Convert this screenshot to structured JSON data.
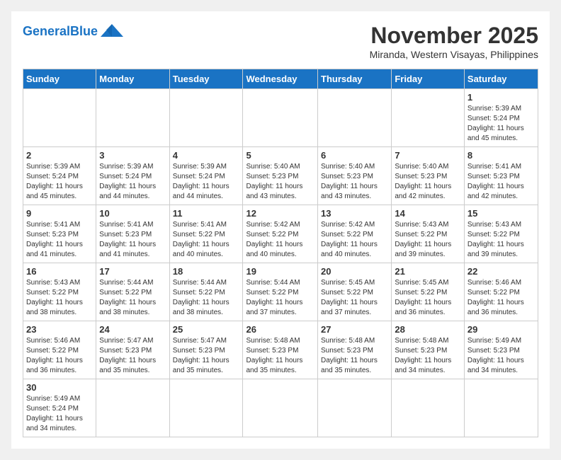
{
  "header": {
    "logo_general": "General",
    "logo_blue": "Blue",
    "month": "November 2025",
    "location": "Miranda, Western Visayas, Philippines"
  },
  "days_of_week": [
    "Sunday",
    "Monday",
    "Tuesday",
    "Wednesday",
    "Thursday",
    "Friday",
    "Saturday"
  ],
  "weeks": [
    [
      {
        "day": "",
        "info": ""
      },
      {
        "day": "",
        "info": ""
      },
      {
        "day": "",
        "info": ""
      },
      {
        "day": "",
        "info": ""
      },
      {
        "day": "",
        "info": ""
      },
      {
        "day": "",
        "info": ""
      },
      {
        "day": "1",
        "info": "Sunrise: 5:39 AM\nSunset: 5:24 PM\nDaylight: 11 hours\nand 45 minutes."
      }
    ],
    [
      {
        "day": "2",
        "info": "Sunrise: 5:39 AM\nSunset: 5:24 PM\nDaylight: 11 hours\nand 45 minutes."
      },
      {
        "day": "3",
        "info": "Sunrise: 5:39 AM\nSunset: 5:24 PM\nDaylight: 11 hours\nand 44 minutes."
      },
      {
        "day": "4",
        "info": "Sunrise: 5:39 AM\nSunset: 5:24 PM\nDaylight: 11 hours\nand 44 minutes."
      },
      {
        "day": "5",
        "info": "Sunrise: 5:40 AM\nSunset: 5:23 PM\nDaylight: 11 hours\nand 43 minutes."
      },
      {
        "day": "6",
        "info": "Sunrise: 5:40 AM\nSunset: 5:23 PM\nDaylight: 11 hours\nand 43 minutes."
      },
      {
        "day": "7",
        "info": "Sunrise: 5:40 AM\nSunset: 5:23 PM\nDaylight: 11 hours\nand 42 minutes."
      },
      {
        "day": "8",
        "info": "Sunrise: 5:41 AM\nSunset: 5:23 PM\nDaylight: 11 hours\nand 42 minutes."
      }
    ],
    [
      {
        "day": "9",
        "info": "Sunrise: 5:41 AM\nSunset: 5:23 PM\nDaylight: 11 hours\nand 41 minutes."
      },
      {
        "day": "10",
        "info": "Sunrise: 5:41 AM\nSunset: 5:23 PM\nDaylight: 11 hours\nand 41 minutes."
      },
      {
        "day": "11",
        "info": "Sunrise: 5:41 AM\nSunset: 5:22 PM\nDaylight: 11 hours\nand 40 minutes."
      },
      {
        "day": "12",
        "info": "Sunrise: 5:42 AM\nSunset: 5:22 PM\nDaylight: 11 hours\nand 40 minutes."
      },
      {
        "day": "13",
        "info": "Sunrise: 5:42 AM\nSunset: 5:22 PM\nDaylight: 11 hours\nand 40 minutes."
      },
      {
        "day": "14",
        "info": "Sunrise: 5:43 AM\nSunset: 5:22 PM\nDaylight: 11 hours\nand 39 minutes."
      },
      {
        "day": "15",
        "info": "Sunrise: 5:43 AM\nSunset: 5:22 PM\nDaylight: 11 hours\nand 39 minutes."
      }
    ],
    [
      {
        "day": "16",
        "info": "Sunrise: 5:43 AM\nSunset: 5:22 PM\nDaylight: 11 hours\nand 38 minutes."
      },
      {
        "day": "17",
        "info": "Sunrise: 5:44 AM\nSunset: 5:22 PM\nDaylight: 11 hours\nand 38 minutes."
      },
      {
        "day": "18",
        "info": "Sunrise: 5:44 AM\nSunset: 5:22 PM\nDaylight: 11 hours\nand 38 minutes."
      },
      {
        "day": "19",
        "info": "Sunrise: 5:44 AM\nSunset: 5:22 PM\nDaylight: 11 hours\nand 37 minutes."
      },
      {
        "day": "20",
        "info": "Sunrise: 5:45 AM\nSunset: 5:22 PM\nDaylight: 11 hours\nand 37 minutes."
      },
      {
        "day": "21",
        "info": "Sunrise: 5:45 AM\nSunset: 5:22 PM\nDaylight: 11 hours\nand 36 minutes."
      },
      {
        "day": "22",
        "info": "Sunrise: 5:46 AM\nSunset: 5:22 PM\nDaylight: 11 hours\nand 36 minutes."
      }
    ],
    [
      {
        "day": "23",
        "info": "Sunrise: 5:46 AM\nSunset: 5:22 PM\nDaylight: 11 hours\nand 36 minutes."
      },
      {
        "day": "24",
        "info": "Sunrise: 5:47 AM\nSunset: 5:23 PM\nDaylight: 11 hours\nand 35 minutes."
      },
      {
        "day": "25",
        "info": "Sunrise: 5:47 AM\nSunset: 5:23 PM\nDaylight: 11 hours\nand 35 minutes."
      },
      {
        "day": "26",
        "info": "Sunrise: 5:48 AM\nSunset: 5:23 PM\nDaylight: 11 hours\nand 35 minutes."
      },
      {
        "day": "27",
        "info": "Sunrise: 5:48 AM\nSunset: 5:23 PM\nDaylight: 11 hours\nand 35 minutes."
      },
      {
        "day": "28",
        "info": "Sunrise: 5:48 AM\nSunset: 5:23 PM\nDaylight: 11 hours\nand 34 minutes."
      },
      {
        "day": "29",
        "info": "Sunrise: 5:49 AM\nSunset: 5:23 PM\nDaylight: 11 hours\nand 34 minutes."
      }
    ],
    [
      {
        "day": "30",
        "info": "Sunrise: 5:49 AM\nSunset: 5:24 PM\nDaylight: 11 hours\nand 34 minutes."
      },
      {
        "day": "",
        "info": ""
      },
      {
        "day": "",
        "info": ""
      },
      {
        "day": "",
        "info": ""
      },
      {
        "day": "",
        "info": ""
      },
      {
        "day": "",
        "info": ""
      },
      {
        "day": "",
        "info": ""
      }
    ]
  ]
}
